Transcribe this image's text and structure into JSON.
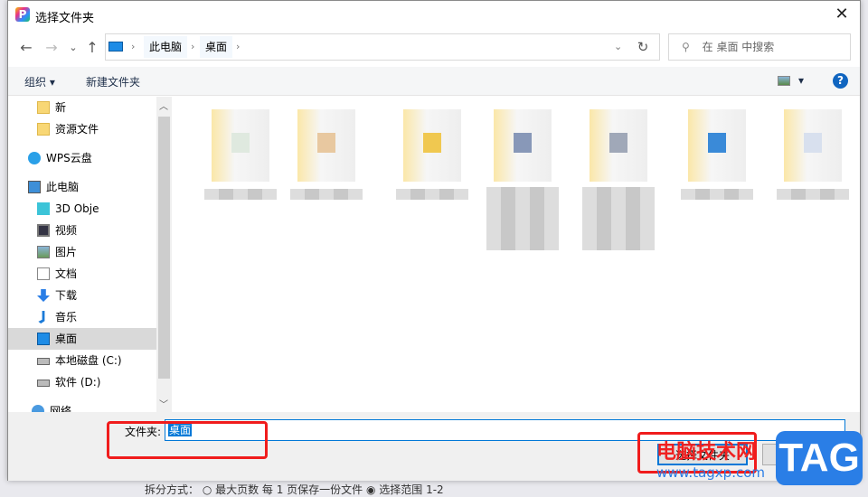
{
  "window": {
    "title": "选择文件夹",
    "close": "✕"
  },
  "nav": {
    "back": "←",
    "forward": "→",
    "recent": "⌄",
    "up": "↑",
    "breadcrumb": [
      "此电脑",
      "桌面"
    ],
    "refresh": "↻",
    "search_placeholder": "在 桌面 中搜索"
  },
  "toolbar": {
    "organize": "组织 ▾",
    "new_folder": "新建文件夹",
    "view": "▾",
    "help": "?"
  },
  "sidebar": {
    "items": [
      {
        "label": "新",
        "icon": "folder-icon"
      },
      {
        "label": "资源文件",
        "icon": "folder-icon"
      },
      {
        "label": "WPS云盘",
        "icon": "cloud-icon"
      },
      {
        "label": "此电脑",
        "icon": "computer-icon"
      },
      {
        "label": "3D Obje",
        "icon": "cube-icon"
      },
      {
        "label": "视频",
        "icon": "video-icon"
      },
      {
        "label": "图片",
        "icon": "picture-icon"
      },
      {
        "label": "文档",
        "icon": "document-icon"
      },
      {
        "label": "下载",
        "icon": "download-icon"
      },
      {
        "label": "音乐",
        "icon": "music-icon"
      },
      {
        "label": "桌面",
        "icon": "desktop-icon",
        "selected": true
      },
      {
        "label": "本地磁盘 (C:)",
        "icon": "drive-icon"
      },
      {
        "label": "软件 (D:)",
        "icon": "drive-icon"
      },
      {
        "label": "网络",
        "icon": "network-icon"
      }
    ]
  },
  "footer": {
    "folder_label": "文件夹:",
    "folder_value": "桌面",
    "select_button": "选择文件夹",
    "cancel_button": "取消"
  },
  "watermark": {
    "site_name": "电脑技术网",
    "url": "www.tagxp.com",
    "logo": "TAG"
  },
  "background_app": {
    "text": "拆分方式：  ○ 最大页数   每 1   页保存一份文件    ◉ 选择范围  1-2"
  },
  "colors": {
    "accent": "#0078d7",
    "help": "#1065c0",
    "annotation": "#f01c1c",
    "tag": "#2a7ee6"
  }
}
